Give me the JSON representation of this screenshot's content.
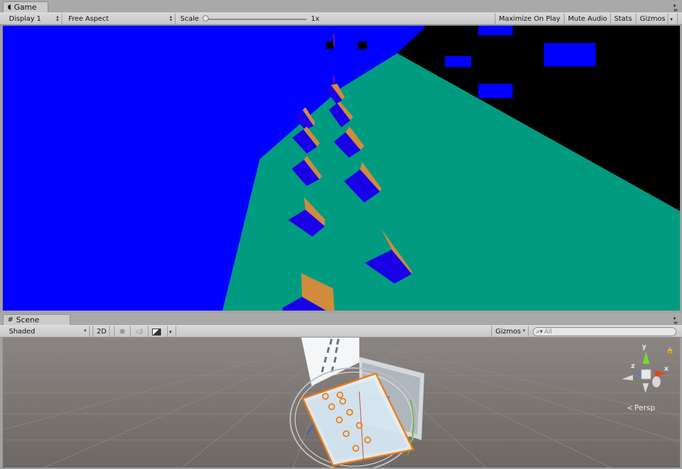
{
  "game": {
    "tab_label": "Game",
    "tab_icon": "pacman-icon",
    "display": "Display 1",
    "aspect": "Free Aspect",
    "scale_label": "Scale",
    "scale_value": "1x",
    "scale_slider_fraction": 0.0,
    "maximize_on_play": "Maximize On Play",
    "mute_audio": "Mute Audio",
    "stats": "Stats",
    "gizmos": "Gizmos"
  },
  "scene": {
    "tab_label": "Scene",
    "tab_icon": "hash-icon",
    "shading_mode": "Shaded",
    "mode_2d": "2D",
    "gizmos": "Gizmos",
    "search_placeholder": "All",
    "projection_label": "Persp",
    "axis_labels": {
      "y": "y",
      "z": "z",
      "x": "x"
    }
  },
  "colors": {
    "sky_blue": "#0000ff",
    "ground_teal": "#009b80",
    "void_black": "#000000",
    "cube_top": "#1a00e6",
    "cube_side": "#d08c3c",
    "selection_orange": "#f07a10",
    "editor_gray": "#a2a2a2"
  }
}
